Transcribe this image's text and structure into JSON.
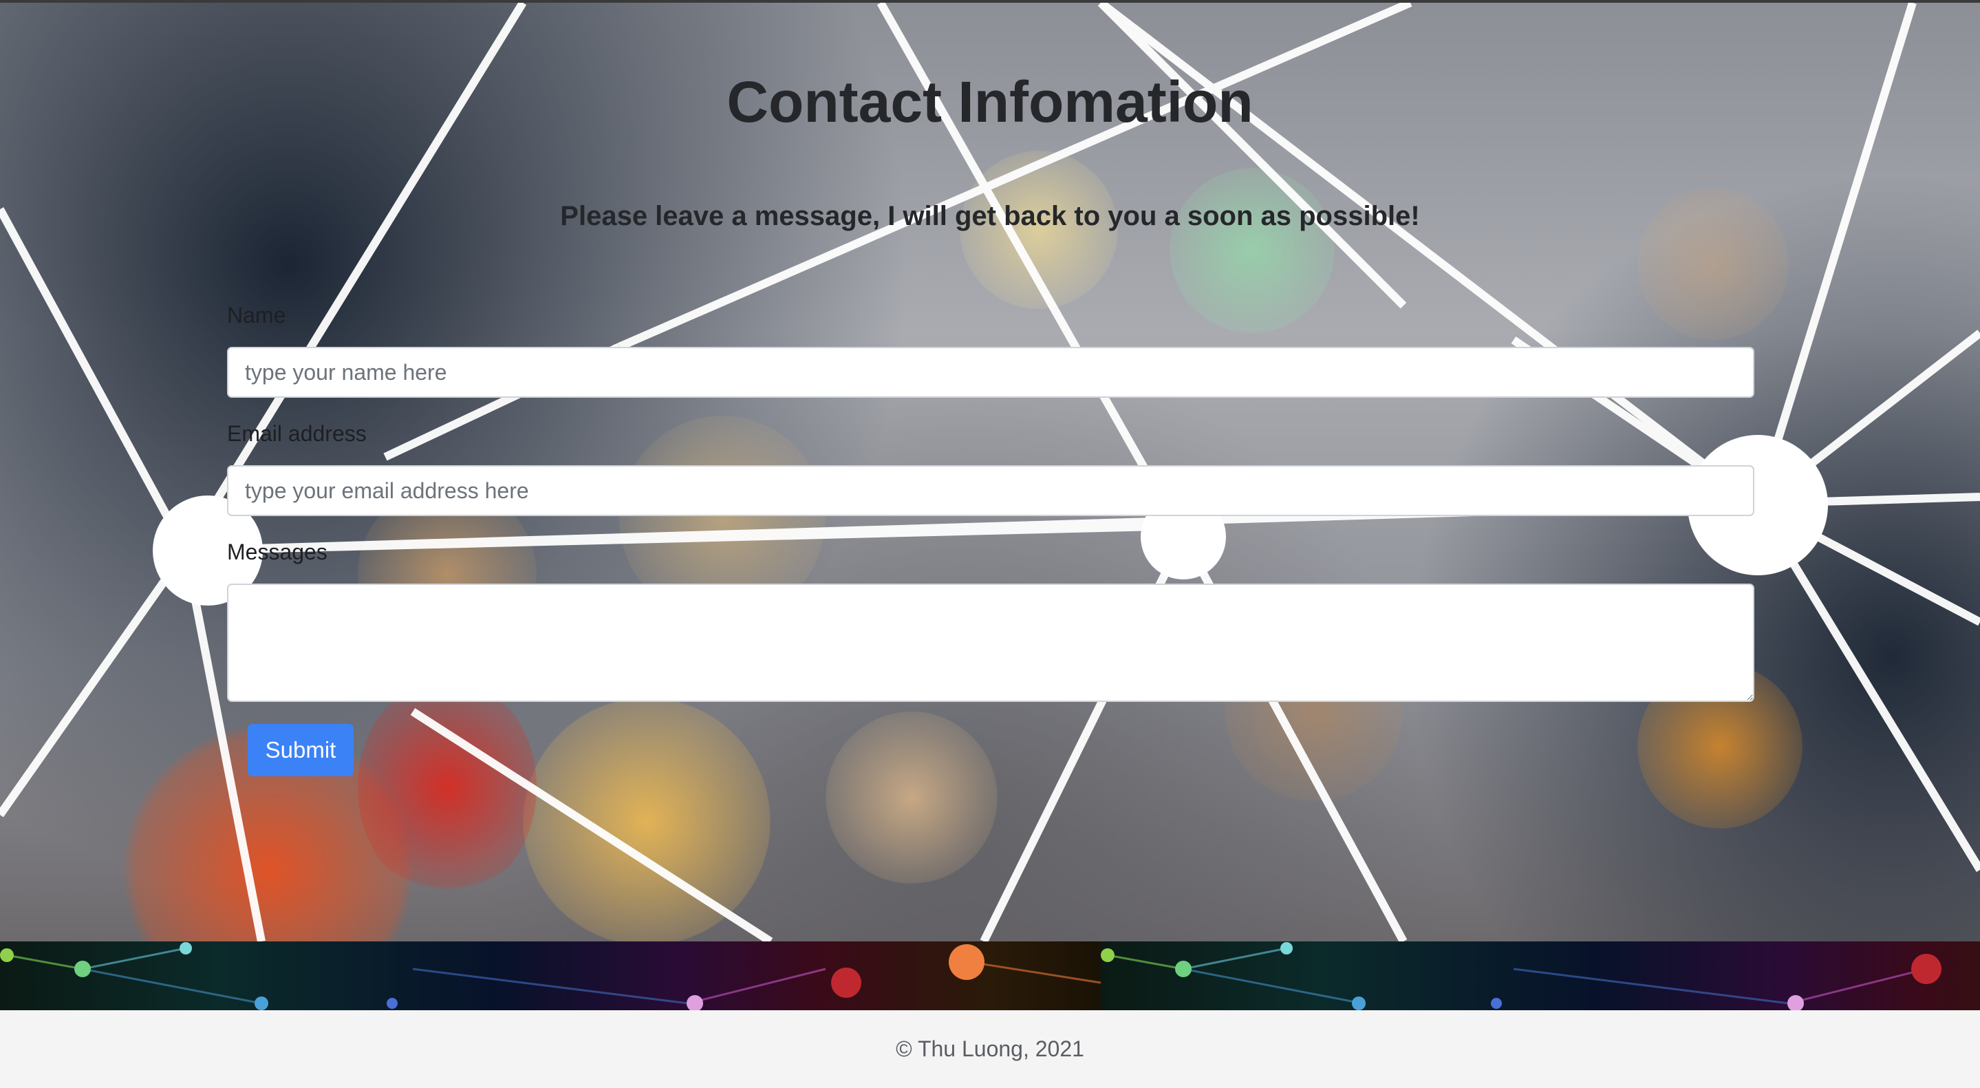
{
  "page": {
    "title": "Contact Infomation",
    "subtitle": "Please leave a message, I will get back to you a soon as possible!"
  },
  "form": {
    "name_label": "Name",
    "name_placeholder": "type your name here",
    "name_value": "",
    "email_label": "Email address",
    "email_placeholder": "type your email address here",
    "email_value": "",
    "messages_label": "Messages",
    "messages_value": "",
    "submit_label": "Submit"
  },
  "footer": {
    "copyright": "© Thu Luong, 2021"
  },
  "colors": {
    "accent": "#3b82f6",
    "title_text": "#25272b",
    "footer_bg": "#f4f4f4",
    "footer_text": "#5a5d62"
  }
}
